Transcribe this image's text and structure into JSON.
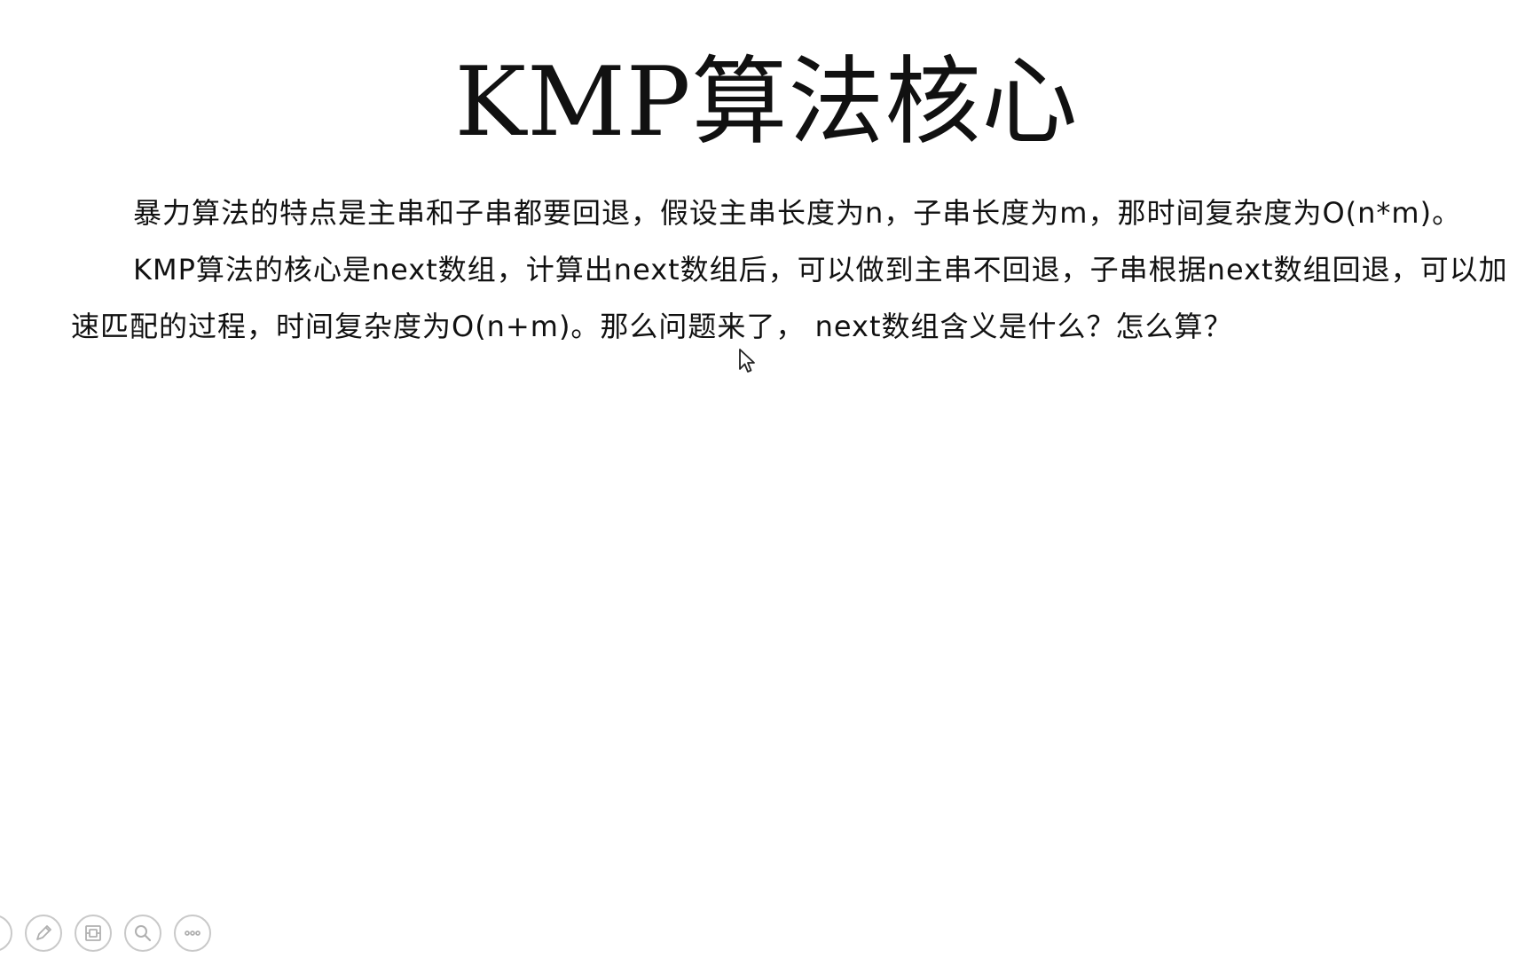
{
  "slide": {
    "title": "KMP算法核心",
    "paragraphs": [
      "暴力算法的特点是主串和子串都要回退，假设主串长度为n，子串长度为m，那时间复杂度为O(n*m)。",
      "KMP算法的核心是next数组，计算出next数组后，可以做到主串不回退，子串根据next数组回退，可以加速匹配的过程，时间复杂度为O(n+m)。那么问题来了， next数组含义是什么？怎么算？"
    ]
  },
  "toolbar": {
    "icons": [
      "partial-button-icon",
      "pen-icon",
      "slides-icon",
      "zoom-icon",
      "more-icon"
    ]
  },
  "colors": {
    "background": "#ffffff",
    "text": "#111111",
    "toolbar_icon": "#b0b0b0",
    "toolbar_border": "#c9c9c9"
  }
}
